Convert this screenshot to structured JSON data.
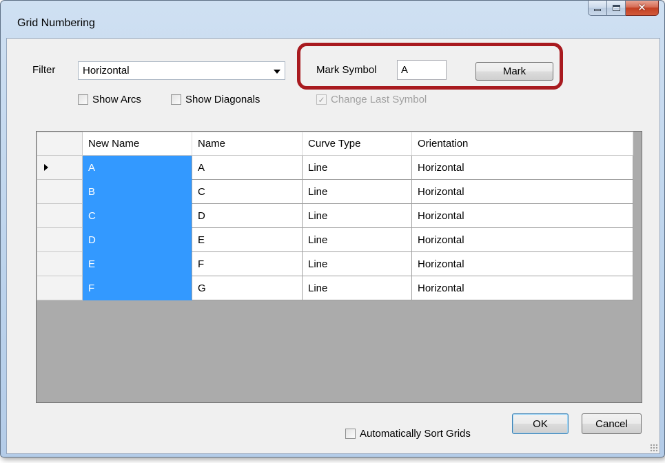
{
  "window": {
    "title": "Grid Numbering",
    "close_glyph": "✕"
  },
  "filter": {
    "label": "Filter",
    "selected": "Horizontal",
    "show_arcs_label": "Show Arcs",
    "show_arcs_checked": false,
    "show_diagonals_label": "Show Diagonals",
    "show_diagonals_checked": false
  },
  "mark": {
    "label": "Mark Symbol",
    "value": "A",
    "button_label": "Mark",
    "change_last_label": "Change Last Symbol",
    "change_last_checked": true,
    "change_last_enabled": false,
    "highlight_color": "#a81a1f"
  },
  "grid": {
    "columns": [
      "New Name",
      "Name",
      "Curve Type",
      "Orientation"
    ],
    "rows": [
      {
        "new_name": "A",
        "name": "A",
        "curve_type": "Line",
        "orientation": "Horizontal",
        "current": true
      },
      {
        "new_name": "B",
        "name": "C",
        "curve_type": "Line",
        "orientation": "Horizontal",
        "current": false
      },
      {
        "new_name": "C",
        "name": "D",
        "curve_type": "Line",
        "orientation": "Horizontal",
        "current": false
      },
      {
        "new_name": "D",
        "name": "E",
        "curve_type": "Line",
        "orientation": "Horizontal",
        "current": false
      },
      {
        "new_name": "E",
        "name": "F",
        "curve_type": "Line",
        "orientation": "Horizontal",
        "current": false
      },
      {
        "new_name": "F",
        "name": "G",
        "curve_type": "Line",
        "orientation": "Horizontal",
        "current": false
      }
    ],
    "selection_color": "#3399ff"
  },
  "footer": {
    "auto_sort_label": "Automatically Sort Grids",
    "auto_sort_checked": false,
    "ok_label": "OK",
    "cancel_label": "Cancel"
  }
}
